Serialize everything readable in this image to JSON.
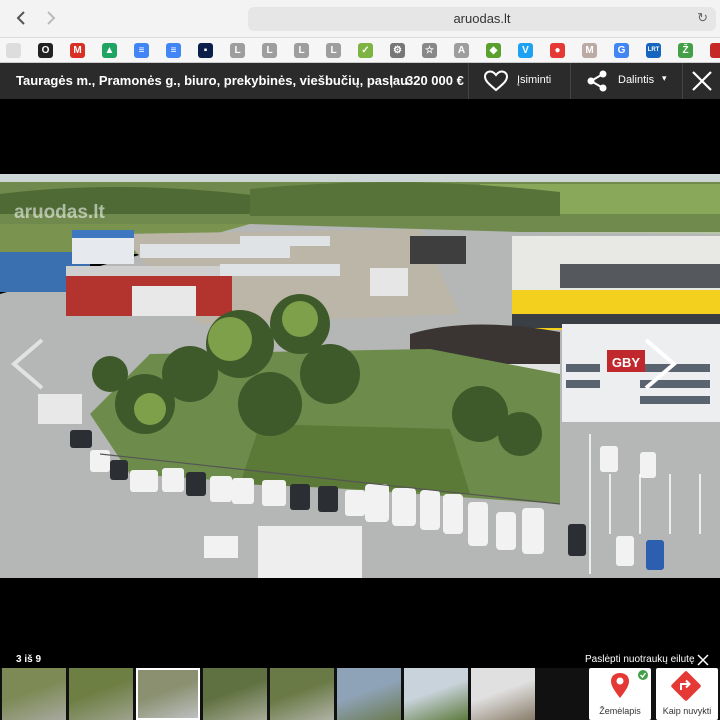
{
  "browser": {
    "url": "aruodas.lt",
    "back_icon": "chevron-left-icon",
    "forward_icon": "chevron-right-icon",
    "reload_icon": "reload-icon"
  },
  "bookmarks": [
    {
      "name": "bookmark-1",
      "glyph": "",
      "color": "#dddddd"
    },
    {
      "name": "bookmark-2",
      "glyph": "O",
      "color": "#222222"
    },
    {
      "name": "gmail",
      "glyph": "M",
      "color": "#d93025"
    },
    {
      "name": "drive",
      "glyph": "▲",
      "color": "#1fa463"
    },
    {
      "name": "docs",
      "glyph": "≡",
      "color": "#4285f4"
    },
    {
      "name": "docs-2",
      "glyph": "≡",
      "color": "#4285f4"
    },
    {
      "name": "bookmark-7",
      "glyph": "▪",
      "color": "#0b1f4a"
    },
    {
      "name": "bookmark-l-1",
      "glyph": "L",
      "color": "#9e9e9e"
    },
    {
      "name": "bookmark-l-2",
      "glyph": "L",
      "color": "#9e9e9e"
    },
    {
      "name": "bookmark-l-3",
      "glyph": "L",
      "color": "#9e9e9e"
    },
    {
      "name": "bookmark-l-4",
      "glyph": "L",
      "color": "#9e9e9e"
    },
    {
      "name": "bookmark-chat",
      "glyph": "✓",
      "color": "#7cb342"
    },
    {
      "name": "bookmark-gear",
      "glyph": "⚙",
      "color": "#777777"
    },
    {
      "name": "bookmark-star",
      "glyph": "☆",
      "color": "#888888"
    },
    {
      "name": "bookmark-a",
      "glyph": "A",
      "color": "#9e9e9e"
    },
    {
      "name": "bookmark-puzzle",
      "glyph": "◆",
      "color": "#5aa02c"
    },
    {
      "name": "bookmark-v",
      "glyph": "V",
      "color": "#1da1f2"
    },
    {
      "name": "bookmark-red",
      "glyph": "●",
      "color": "#e53935"
    },
    {
      "name": "bookmark-m",
      "glyph": "M",
      "color": "#bcaaa4"
    },
    {
      "name": "google",
      "glyph": "G",
      "color": "#4285f4"
    },
    {
      "name": "bookmark-lrt",
      "glyph": "LRT",
      "color": "#1565c0"
    },
    {
      "name": "bookmark-z",
      "glyph": "Ž",
      "color": "#43a047"
    },
    {
      "name": "bookmark-last",
      "glyph": "",
      "color": "#c62828"
    }
  ],
  "header": {
    "title": "Tauragės m., Pramonės g., biuro, prekybinės, viešbučių, paslau",
    "separator": "|",
    "price": "320 000 € (",
    "save_label": "Įsiminti",
    "share_label": "Dalintis",
    "share_caret": "▾"
  },
  "photo": {
    "watermark": "aruodas.lt",
    "sign_text": "GBY",
    "sky_color": "#d8dde2",
    "asphalt_color": "#b9bcbd",
    "field_color": "#6d8b4a",
    "building_yellow": "#f3cf1e"
  },
  "gallery": {
    "counter": "3 iš 9",
    "hide_label": "Paslėpti nuotraukų eilutę",
    "map_label": "Žemėlapis",
    "route_label": "Kaip nuvykti"
  },
  "thumbs": [
    {
      "name": "thumb-1",
      "colors": [
        "#7d8a55",
        "#a8a9a0"
      ]
    },
    {
      "name": "thumb-2",
      "colors": [
        "#6e7f44",
        "#9ea28e"
      ]
    },
    {
      "name": "thumb-3",
      "colors": [
        "#8a9070",
        "#c0c3c5"
      ]
    },
    {
      "name": "thumb-4",
      "colors": [
        "#5f7140",
        "#a8aa98"
      ]
    },
    {
      "name": "thumb-5",
      "colors": [
        "#6a7a46",
        "#b0b2a6"
      ]
    },
    {
      "name": "thumb-6",
      "colors": [
        "#8fa3b8",
        "#6a7a50"
      ]
    },
    {
      "name": "thumb-7",
      "colors": [
        "#c9d3dc",
        "#5d7a3c"
      ]
    },
    {
      "name": "thumb-8",
      "colors": [
        "#e0e0e0",
        "#8a7d6a"
      ]
    },
    {
      "name": "thumb-9",
      "colors": [
        "#5c8a34",
        "#3f6a22"
      ]
    }
  ]
}
